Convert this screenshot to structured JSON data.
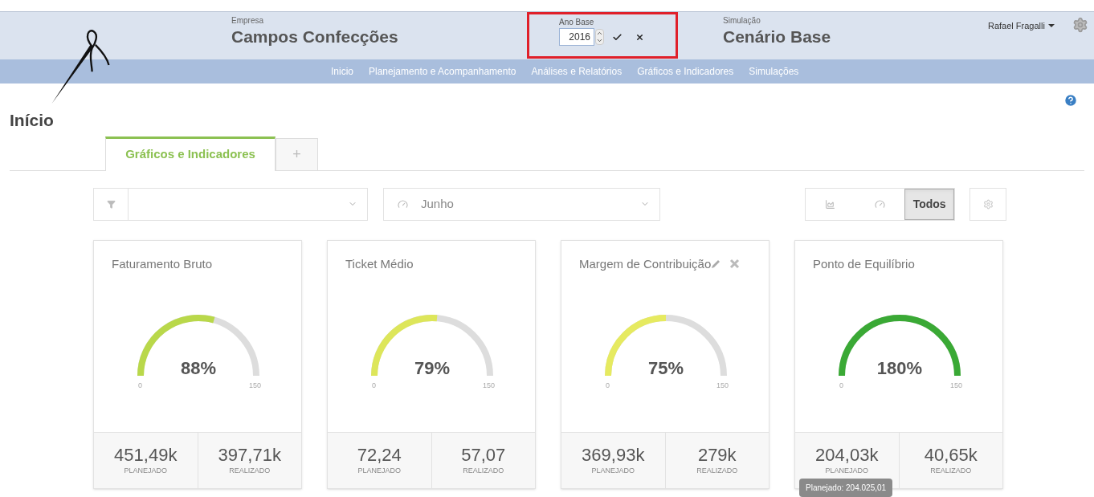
{
  "header": {
    "company_label": "Empresa",
    "company": "Campos Confecções",
    "year_label": "Ano Base",
    "year_value": "2016",
    "simulation_label": "Simulação",
    "simulation": "Cenário Base",
    "user": "Rafael Fragalli"
  },
  "nav": [
    {
      "label": "Inicio"
    },
    {
      "label": "Planejamento e Acompanhamento"
    },
    {
      "label": "Análises e Relatórios"
    },
    {
      "label": "Gráficos e Indicadores"
    },
    {
      "label": "Simulações"
    }
  ],
  "page_title": "Início",
  "tabs": [
    {
      "label": "Gráficos e Indicadores",
      "selected": true
    }
  ],
  "add_tab": "+",
  "filters": {
    "month": "Junho"
  },
  "view_toggle": [
    {
      "kind": "chart",
      "selected": false
    },
    {
      "kind": "gauge",
      "selected": false
    },
    {
      "kind": "label",
      "label": "Todos",
      "selected": true
    }
  ],
  "cards": [
    {
      "title": "Faturamento Bruto",
      "percent": "88%",
      "color": "#b9d84a",
      "min": "0",
      "max": "150",
      "planned": "451,49k",
      "planned_label": "PLANEJADO",
      "realized": "397,71k",
      "realized_label": "REALIZADO",
      "actions": false
    },
    {
      "title": "Ticket Médio",
      "percent": "79%",
      "color": "#dde65a",
      "min": "0",
      "max": "150",
      "planned": "72,24",
      "planned_label": "PLANEJADO",
      "realized": "57,07",
      "realized_label": "REALIZADO",
      "actions": false
    },
    {
      "title": "Margem de Contribuição",
      "percent": "75%",
      "color": "#e6ea60",
      "min": "0",
      "max": "150",
      "planned": "369,93k",
      "planned_label": "PLANEJADO",
      "realized": "279k",
      "realized_label": "REALIZADO",
      "actions": true
    },
    {
      "title": "Ponto de Equilíbrio",
      "percent": "180%",
      "color": "#3aa935",
      "min": "0",
      "max": "150",
      "planned": "204,03k",
      "planned_label": "PLANEJADO",
      "realized": "40,65k",
      "realized_label": "REALIZADO",
      "actions": false,
      "tooltip": "Planejado: 204.025,01"
    }
  ]
}
